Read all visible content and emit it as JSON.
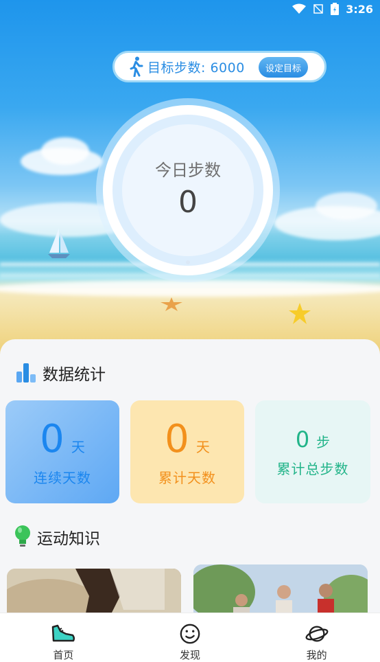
{
  "status_bar": {
    "time": "3:26"
  },
  "goal": {
    "label": "目标步数: 6000",
    "button": "设定目标"
  },
  "today": {
    "label": "今日步数",
    "value": "0"
  },
  "stats": {
    "title": "数据统计",
    "cards": [
      {
        "value": "0",
        "unit": "天",
        "label": "连续天数"
      },
      {
        "value": "0",
        "unit": "天",
        "label": "累计天数"
      },
      {
        "value": "0",
        "unit": "步",
        "label": "累计总步数"
      }
    ]
  },
  "knowledge": {
    "title": "运动知识"
  },
  "nav": [
    {
      "label": "首页",
      "icon": "sneaker-icon"
    },
    {
      "label": "发现",
      "icon": "smile-face-icon"
    },
    {
      "label": "我的",
      "icon": "planet-icon"
    }
  ],
  "colors": {
    "primary_blue": "#2a8de3",
    "stat_blue": "#1b86ef",
    "stat_orange": "#f2901c",
    "stat_green": "#22b489"
  }
}
